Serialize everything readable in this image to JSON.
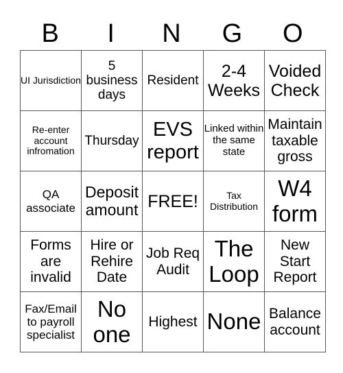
{
  "header": [
    "B",
    "I",
    "N",
    "G",
    "O"
  ],
  "rows": [
    [
      "UI Jurisdiction",
      "5 business days",
      "Resident",
      "2-4 Weeks",
      "Voided Check"
    ],
    [
      "Re-enter account infromation",
      "Thursday",
      "EVS report",
      "Linked within the same state",
      "Maintain taxable gross"
    ],
    [
      "QA associate",
      "Deposit amount",
      "FREE!",
      "Tax Distribution",
      "W4 form"
    ],
    [
      "Forms are invalid",
      "Hire or Rehire Date",
      "Job Req Audit",
      "The Loop",
      "New Start Report"
    ],
    [
      "Fax/Email to payroll specialist",
      "No one",
      "Highest",
      "None",
      "Balance account"
    ]
  ]
}
